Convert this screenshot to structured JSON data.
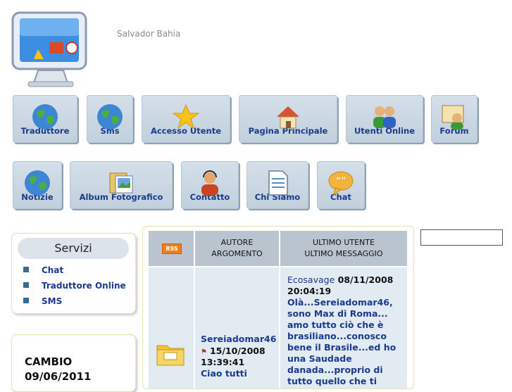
{
  "header": {
    "site_name": "Salvador Bahia"
  },
  "nav": {
    "row1": [
      "Traduttore",
      "Sms",
      "Accesso Utente",
      "Pagina Principale",
      "Utenti Online",
      "Forum"
    ],
    "row2": [
      "Notizie",
      "Album Fotografico",
      "Contatto",
      "Chi Siamo",
      "Chat"
    ]
  },
  "servizi": {
    "title": "Servizi",
    "items": [
      "Chat",
      "Traduttore Online",
      "SMS"
    ]
  },
  "cambio": {
    "line1": "CAMBIO",
    "line2": "09/06/2011"
  },
  "forum": {
    "rss": "RSS",
    "col_author_1": "AUTORE",
    "col_author_2": "ARGOMENTO",
    "col_last_1": "ULTIMO UTENTE",
    "col_last_2": "ULTIMO MESSAGGIO",
    "row": {
      "author": "Sereiadomar46",
      "date": "15/10/2008",
      "time": "13:39:41",
      "topic": "Ciao tutti",
      "last_user": "Ecosavage",
      "last_date": "08/11/2008",
      "last_time": "20:04:19",
      "last_message": "Olà...Sereiadomar46, sono Max di Roma... amo tutto ciò che è brasiliano...conosco bene il Brasile...ed ho una Saudade danada...proprio di tutto quello che ti"
    }
  },
  "colors": {
    "nav_bg": "#c8d5e1",
    "link": "#1a3a8c",
    "rss": "#f07e1b",
    "table_header": "#b9c4cf",
    "table_cell": "#e2eaf2"
  }
}
